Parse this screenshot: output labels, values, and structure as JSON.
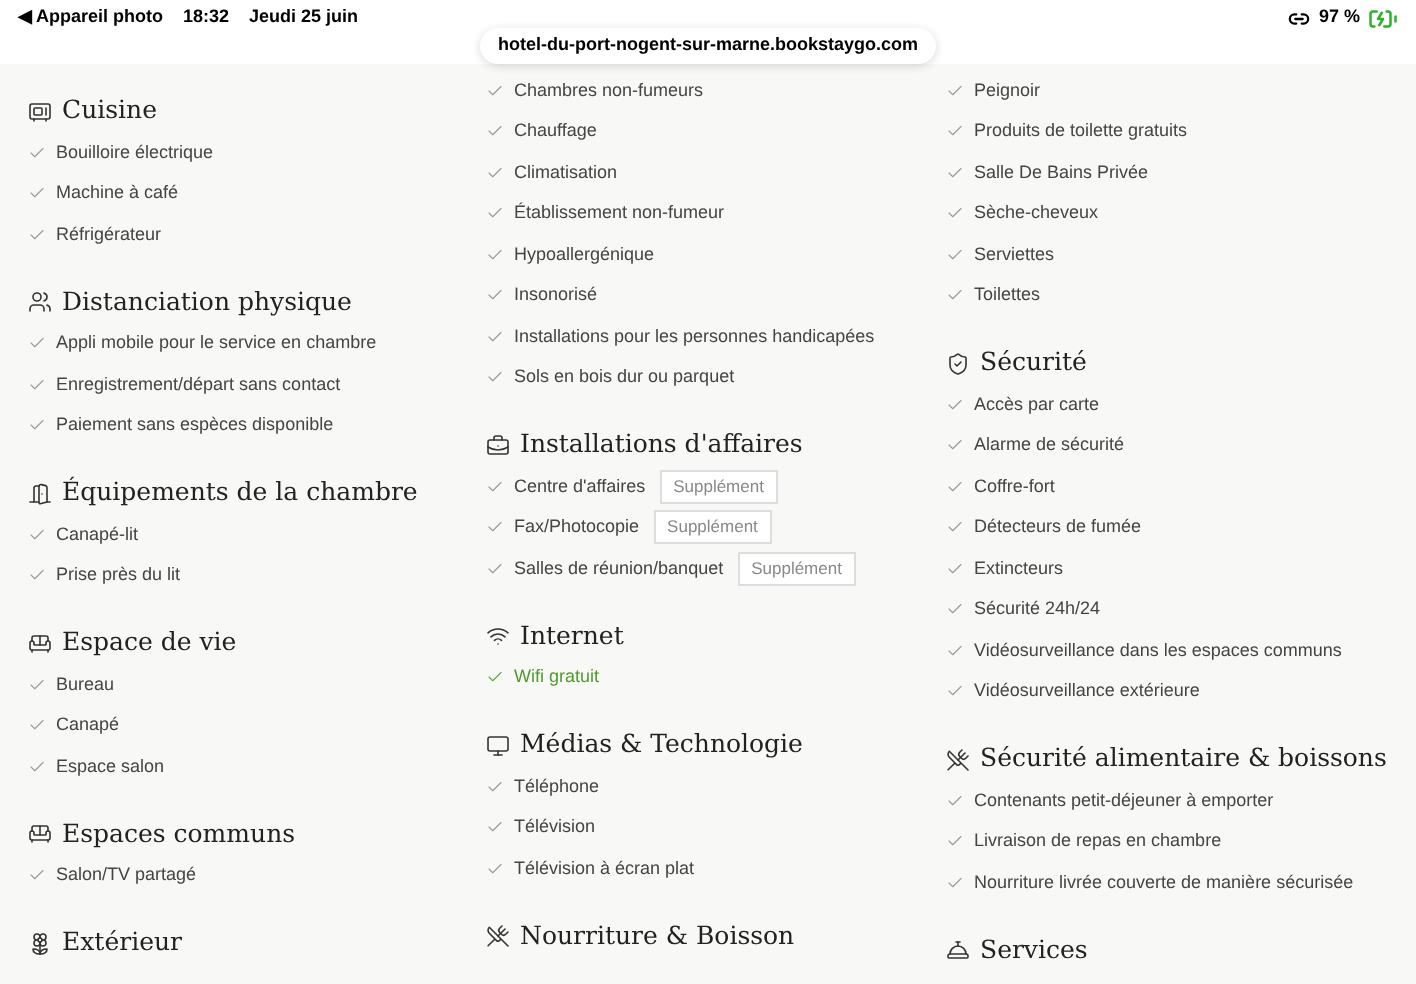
{
  "status_bar": {
    "back_arrow": "◀",
    "back_label": "Appareil photo",
    "time": "18:32",
    "date": "Jeudi 25 juin",
    "battery": "97 %",
    "url": "hotel-du-port-nogent-sur-marne.bookstaygo.com"
  },
  "columns": [
    {
      "sections": [
        {
          "kind": "kitchen",
          "title": "Cuisine",
          "items": [
            {
              "label": "Bouilloire électrique"
            },
            {
              "label": "Machine à café"
            },
            {
              "label": "Réfrigérateur"
            }
          ]
        },
        {
          "kind": "distancing",
          "title": "Distanciation physique",
          "items": [
            {
              "label": "Appli mobile pour le service en chambre"
            },
            {
              "label": "Enregistrement/départ sans contact"
            },
            {
              "label": "Paiement sans espèces disponible"
            }
          ]
        },
        {
          "kind": "room",
          "title": "Équipements de la chambre",
          "items": [
            {
              "label": "Canapé-lit"
            },
            {
              "label": "Prise près du lit"
            }
          ]
        },
        {
          "kind": "sofa",
          "title": "Espace de vie",
          "items": [
            {
              "label": "Bureau"
            },
            {
              "label": "Canapé"
            },
            {
              "label": "Espace salon"
            }
          ]
        },
        {
          "kind": "sofa",
          "title": "Espaces communs",
          "items": [
            {
              "label": "Salon/TV partagé"
            }
          ]
        },
        {
          "kind": "outdoor",
          "title": "Extérieur"
        }
      ]
    },
    {
      "sections": [
        {
          "kind": "none",
          "items": [
            {
              "label": "Chambres non-fumeurs"
            },
            {
              "label": "Chauffage"
            },
            {
              "label": "Climatisation"
            },
            {
              "label": "Établissement non-fumeur"
            },
            {
              "label": "Hypoallergénique"
            },
            {
              "label": "Insonorisé"
            },
            {
              "label": "Installations pour les personnes handicapées"
            },
            {
              "label": "Sols en bois dur ou parquet"
            }
          ]
        },
        {
          "kind": "business",
          "title": "Installations d'affaires",
          "items": [
            {
              "label": "Centre d'affaires",
              "badge": "Supplément"
            },
            {
              "label": "Fax/Photocopie",
              "badge": "Supplément"
            },
            {
              "label": "Salles de réunion/banquet",
              "badge": "Supplément"
            }
          ]
        },
        {
          "kind": "wifi",
          "title": "Internet",
          "items": [
            {
              "label": "Wifi gratuit",
              "highlighted": true
            }
          ]
        },
        {
          "kind": "media",
          "title": "Médias & Technologie",
          "items": [
            {
              "label": "Téléphone"
            },
            {
              "label": "Télévision"
            },
            {
              "label": "Télévision à écran plat"
            }
          ]
        },
        {
          "kind": "food",
          "title": "Nourriture & Boisson"
        }
      ]
    },
    {
      "sections": [
        {
          "kind": "none",
          "items": [
            {
              "label": "Peignoir"
            },
            {
              "label": "Produits de toilette gratuits"
            },
            {
              "label": "Salle De Bains Privée"
            },
            {
              "label": "Sèche-cheveux"
            },
            {
              "label": "Serviettes"
            },
            {
              "label": "Toilettes"
            }
          ]
        },
        {
          "kind": "security",
          "title": "Sécurité",
          "items": [
            {
              "label": "Accès par carte"
            },
            {
              "label": "Alarme de sécurité"
            },
            {
              "label": "Coffre-fort"
            },
            {
              "label": "Détecteurs de fumée"
            },
            {
              "label": "Extincteurs"
            },
            {
              "label": "Sécurité 24h/24"
            },
            {
              "label": "Vidéosurveillance dans les espaces communs"
            },
            {
              "label": "Vidéosurveillance extérieure"
            }
          ]
        },
        {
          "kind": "food",
          "title": "Sécurité alimentaire & boissons",
          "items": [
            {
              "label": "Contenants petit-déjeuner à emporter"
            },
            {
              "label": "Livraison de repas en chambre"
            },
            {
              "label": "Nourriture livrée couverte de manière sécurisée"
            }
          ]
        },
        {
          "kind": "services",
          "title": "Services"
        }
      ]
    }
  ]
}
